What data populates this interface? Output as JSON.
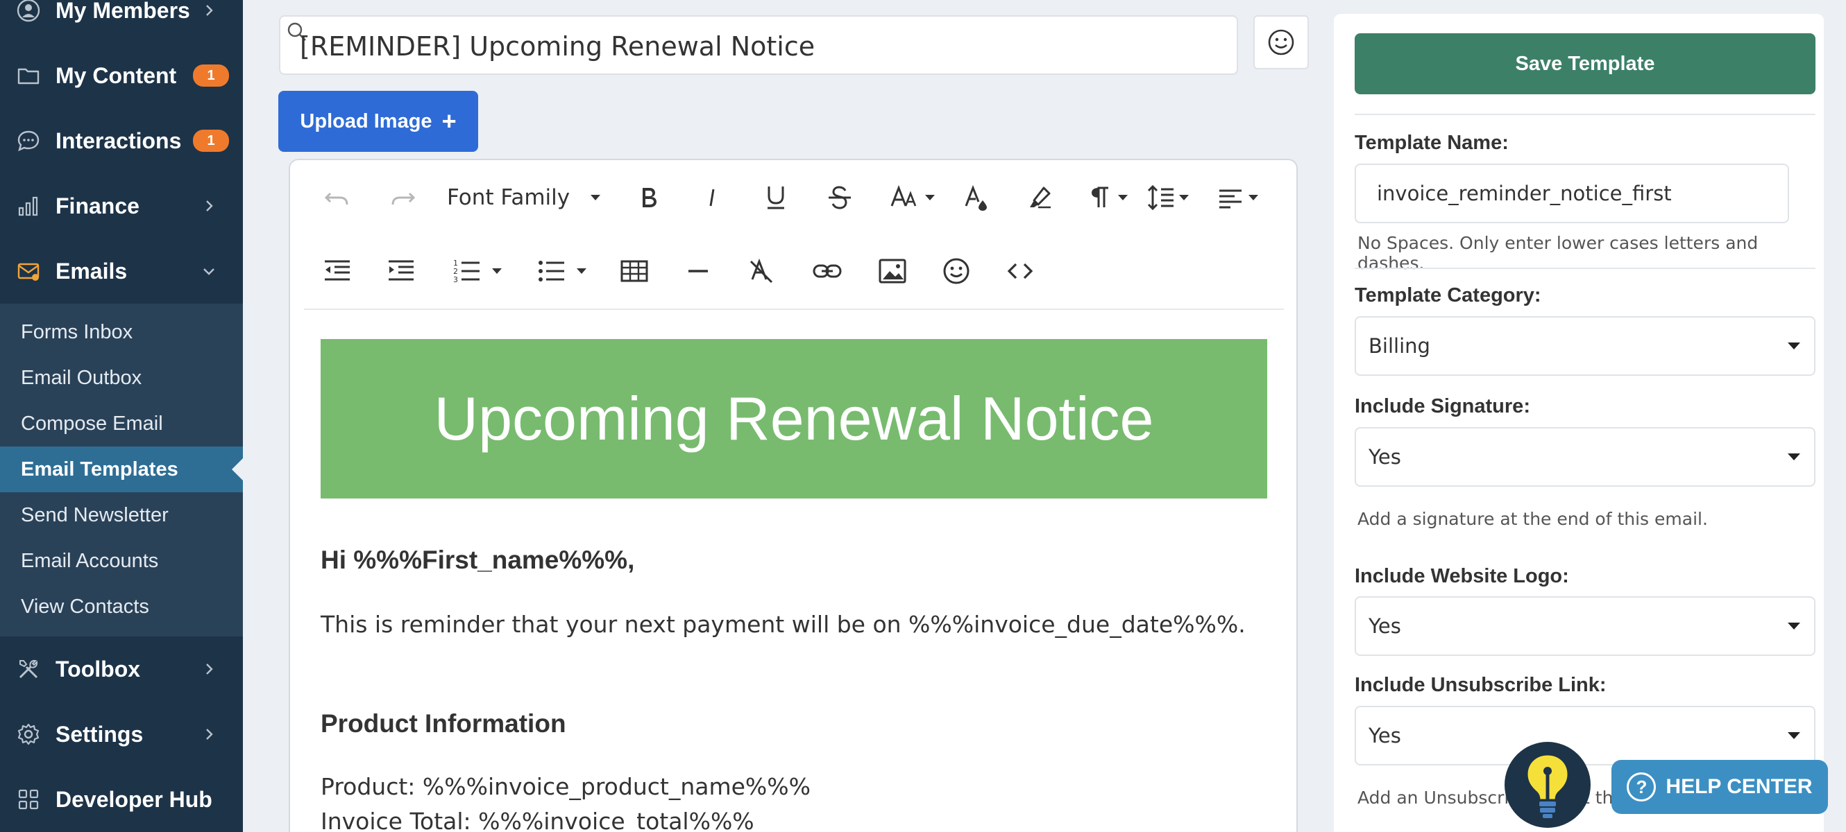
{
  "sidebar": {
    "nav": [
      {
        "label": "My Members",
        "icon": "user-icon"
      },
      {
        "label": "My Content",
        "icon": "folder-icon",
        "badge": "1"
      },
      {
        "label": "Interactions",
        "icon": "chat-icon",
        "badge": "1"
      },
      {
        "label": "Finance",
        "icon": "bar-chart-icon"
      },
      {
        "label": "Emails",
        "icon": "email-icon"
      },
      {
        "label": "Toolbox",
        "icon": "tools-icon"
      },
      {
        "label": "Settings",
        "icon": "gear-icon"
      },
      {
        "label": "Developer Hub",
        "icon": "grid-icon"
      }
    ],
    "email_sub": [
      {
        "label": "Forms Inbox"
      },
      {
        "label": "Email Outbox"
      },
      {
        "label": "Compose Email"
      },
      {
        "label": "Email Templates",
        "active": true
      },
      {
        "label": "Send Newsletter"
      },
      {
        "label": "Email Accounts"
      },
      {
        "label": "View Contacts"
      }
    ]
  },
  "editor": {
    "subject": "[REMINDER] Upcoming Renewal Notice",
    "upload_label": "Upload Image",
    "font_family_label": "Font Family",
    "banner_text": "Upcoming Renewal Notice",
    "banner_color": "#78bb6f",
    "greeting": "Hi %%%First_name%%%,",
    "body": "This is reminder that your next payment will be on %%%invoice_due_date%%%.",
    "section_title": "Product Information",
    "product_line": "Product: %%%invoice_product_name%%%",
    "total_line": "Invoice Total: %%%invoice_total%%%"
  },
  "panel": {
    "save_label": "Save Template",
    "template_name_label": "Template Name:",
    "template_name_value": "invoice_reminder_notice_first",
    "template_name_help": "No Spaces. Only enter lower cases letters and dashes.",
    "category_label": "Template Category:",
    "category_value": "Billing",
    "signature_label": "Include Signature:",
    "signature_value": "Yes",
    "signature_help": "Add a signature at the end of this email.",
    "logo_label": "Include Website Logo:",
    "logo_value": "Yes",
    "unsub_label": "Include Unsubscribe Link:",
    "unsub_value": "Yes",
    "unsub_help": "Add an Unsubscribe link at the"
  },
  "widgets": {
    "help_center_label": "HELP CENTER"
  },
  "colors": {
    "sidebar_bg": "#1d3348",
    "active_item": "#2e6e95",
    "badge": "#f07a2c",
    "save_button": "#3c8068",
    "upload_button": "#2e6bd6",
    "help_center": "#3c8fc3"
  }
}
